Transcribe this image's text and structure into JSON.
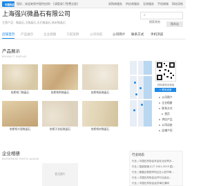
{
  "topbar": {
    "logo_text": "中国供应",
    "notice": "您好，欢迎来到中国供应网！ [请登录] [免费注册]",
    "links": [
      "采购商服务",
      "供应商服务",
      "无线服务",
      "手机商城",
      "网站导航"
    ]
  },
  "company": {
    "name": "上海强兴微晶石有限公司",
    "desc": "主营产品：微晶石,玉微晶石,无孔微晶石,纳米微晶石"
  },
  "search": {
    "placeholder": "搜索其他",
    "button": "搜本店"
  },
  "nav": [
    {
      "label": "店铺首页",
      "state": "active"
    },
    {
      "label": "产品展示",
      "state": "muted"
    },
    {
      "label": "企业相册",
      "state": "muted"
    },
    {
      "label": "工程案例",
      "state": "muted"
    },
    {
      "label": "公司动态",
      "state": "muted"
    },
    {
      "label": "公司简介",
      "state": "normal"
    },
    {
      "label": "联系方式",
      "state": "normal"
    },
    {
      "label": "手机浏览",
      "state": "normal"
    }
  ],
  "products_section": {
    "title": "产品展示",
    "subtitle": "PRODUCT DISPLAY"
  },
  "products": [
    {
      "name": "依斯顿门微晶石",
      "color": "#d8c9a6"
    },
    {
      "name": "依斯顿荆微晶石",
      "color": "#c8a779"
    },
    {
      "name": "依斯顿板微晶石",
      "color": "#e4d9c4"
    },
    {
      "name": "依斯顿大理微晶石",
      "color": "#d0b58b"
    },
    {
      "name": "依斯天花板微晶石",
      "color": "#ddd2bd"
    },
    {
      "name": "依斯顿树微晶石",
      "color": "#e0d3b4"
    }
  ],
  "qr": {
    "caption": "扫码浏览手机站"
  },
  "contact": {
    "button": "+ 联系卖家"
  },
  "side_menu": [
    "公司简介",
    "企业相册",
    "联系方式",
    "首页",
    "供应产品",
    "公司动态",
    "店铺介绍"
  ],
  "album_section": {
    "title": "企业相册",
    "subtitle": "ENTERPRISE PHOTO ALBUM",
    "placeholder": "暂无图片"
  },
  "news": {
    "title": "行业动态",
    "items": [
      "行业 | 中国石材协会年会在北京举办...",
      "行业 | 智能制造 JC/T 1001-2015 国...",
      "行业 | 微晶石新型材料企业入驻市场...",
      "行业 | 中国石材协会召开行业会议...",
      "行业 | 中国石材协会会员单位调研"
    ]
  }
}
